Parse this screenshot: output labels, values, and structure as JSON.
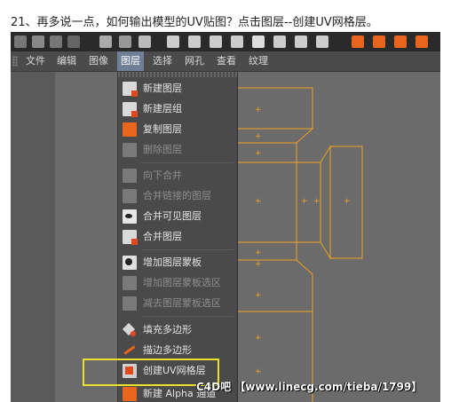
{
  "caption": "21、再多说一点，如何输出模型的UV贴图？点击图层--创建UV网格层。",
  "menubar": {
    "items": [
      {
        "label": "文件",
        "active": false
      },
      {
        "label": "编辑",
        "active": false
      },
      {
        "label": "图像",
        "active": false
      },
      {
        "label": "图层",
        "active": true
      },
      {
        "label": "选择",
        "active": false
      },
      {
        "label": "网孔",
        "active": false
      },
      {
        "label": "查看",
        "active": false
      },
      {
        "label": "纹理",
        "active": false
      }
    ]
  },
  "layer_menu": {
    "items": [
      {
        "label": "新建图层",
        "icon": "new-layer-icon",
        "enabled": true
      },
      {
        "label": "新建层组",
        "icon": "new-layer-group-icon",
        "enabled": true
      },
      {
        "label": "复制图层",
        "icon": "copy-layer-icon",
        "enabled": true
      },
      {
        "label": "删除图层",
        "icon": "delete-layer-icon",
        "enabled": false
      },
      {
        "label": "向下合并",
        "icon": "merge-down-icon",
        "enabled": false
      },
      {
        "label": "合并链接的图层",
        "icon": "merge-linked-icon",
        "enabled": false
      },
      {
        "label": "合并可见图层",
        "icon": "merge-visible-icon",
        "enabled": true
      },
      {
        "label": "合并图层",
        "icon": "merge-layers-icon",
        "enabled": true
      },
      {
        "label": "增加图层蒙板",
        "icon": "add-mask-icon",
        "enabled": true
      },
      {
        "label": "增加图层蒙板选区",
        "icon": "add-mask-selection-icon",
        "enabled": false
      },
      {
        "label": "减去图层蒙板选区",
        "icon": "subtract-mask-selection-icon",
        "enabled": false
      },
      {
        "label": "填充多边形",
        "icon": "fill-polygon-icon",
        "enabled": true
      },
      {
        "label": "描边多边形",
        "icon": "stroke-polygon-icon",
        "enabled": true
      },
      {
        "label": "创建UV网格层",
        "icon": "create-uv-mesh-layer-icon",
        "enabled": true
      },
      {
        "label": "新建 Alpha 通道",
        "icon": "new-alpha-channel-icon",
        "enabled": true
      }
    ]
  },
  "watermark": "C4D吧 【www.linecg.com/tieba/1799】",
  "colors": {
    "uv_lines": "#f0a020",
    "highlight": "#e9e12c",
    "menu_bg": "#4a4a4a",
    "active_menu": "#6f7f95"
  }
}
